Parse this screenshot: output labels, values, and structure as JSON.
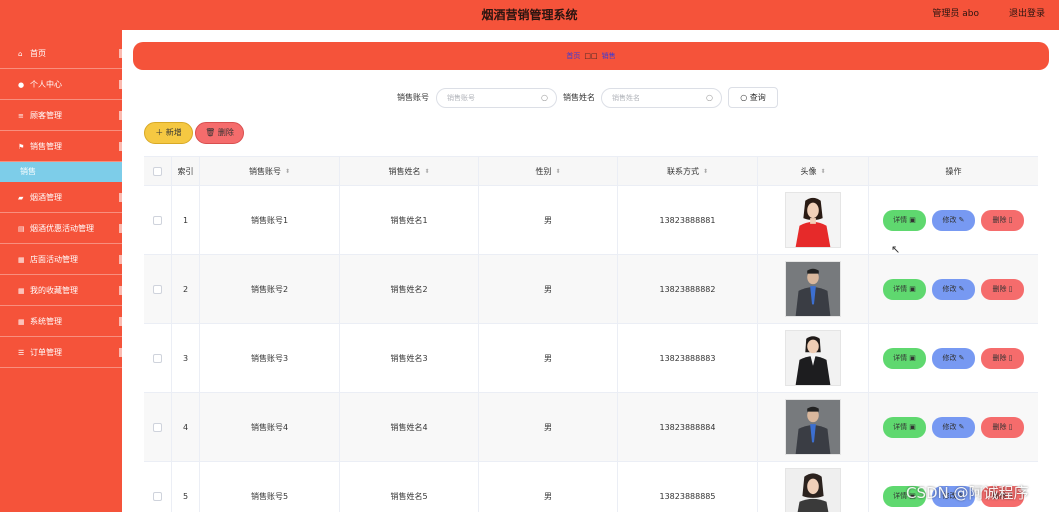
{
  "header": {
    "title": "烟酒营销管理系统",
    "user": "管理员 abo",
    "logout": "退出登录"
  },
  "sidebar": {
    "items": [
      {
        "icon": "home-icon",
        "glyph": "⌂",
        "label": "首页"
      },
      {
        "icon": "user-icon",
        "glyph": "●",
        "label": "个人中心"
      },
      {
        "icon": "customer-icon",
        "glyph": "≡",
        "label": "顾客管理"
      },
      {
        "icon": "flag-icon",
        "glyph": "⚑",
        "label": "销售管理"
      },
      {
        "icon": "cigarette-icon",
        "glyph": "▰",
        "label": "烟酒管理"
      },
      {
        "icon": "promo-icon",
        "glyph": "▤",
        "label": "烟酒优惠活动管理"
      },
      {
        "icon": "store-icon",
        "glyph": "▦",
        "label": "店面活动管理"
      },
      {
        "icon": "favorite-icon",
        "glyph": "▦",
        "label": "我的收藏管理"
      },
      {
        "icon": "system-icon",
        "glyph": "▦",
        "label": "系统管理"
      },
      {
        "icon": "order-icon",
        "glyph": "☰",
        "label": "订单管理"
      }
    ],
    "submenu_label": "销售"
  },
  "breadcrumb": {
    "home": "首页",
    "sep": "□□",
    "current": "销售"
  },
  "search": {
    "account_label": "销售账号",
    "account_placeholder": "销售账号",
    "name_label": "销售姓名",
    "name_placeholder": "销售姓名",
    "query_label": "查询"
  },
  "actions": {
    "add_label": "新增",
    "delete_label": "删除"
  },
  "table": {
    "headers": {
      "index": "索引",
      "account": "销售账号",
      "name": "销售姓名",
      "gender": "性别",
      "phone": "联系方式",
      "avatar": "头像",
      "ops": "操作"
    },
    "rows": [
      {
        "index": "1",
        "account": "销售账号1",
        "name": "销售姓名1",
        "gender": "男",
        "phone": "13823888881"
      },
      {
        "index": "2",
        "account": "销售账号2",
        "name": "销售姓名2",
        "gender": "男",
        "phone": "13823888882"
      },
      {
        "index": "3",
        "account": "销售账号3",
        "name": "销售姓名3",
        "gender": "男",
        "phone": "13823888883"
      },
      {
        "index": "4",
        "account": "销售账号4",
        "name": "销售姓名4",
        "gender": "男",
        "phone": "13823888884"
      },
      {
        "index": "5",
        "account": "销售账号5",
        "name": "销售姓名5",
        "gender": "男",
        "phone": "13823888885"
      }
    ],
    "row_buttons": {
      "detail": "详情",
      "edit": "修改",
      "delete": "删除"
    }
  },
  "watermark": "CSDN @阿诚程序",
  "colors": {
    "primary": "#f5533a",
    "submenu": "#7dcde9",
    "add": "#f5c842",
    "delete": "#f56c6c",
    "detail": "#5fd86f",
    "edit": "#7799f2"
  }
}
